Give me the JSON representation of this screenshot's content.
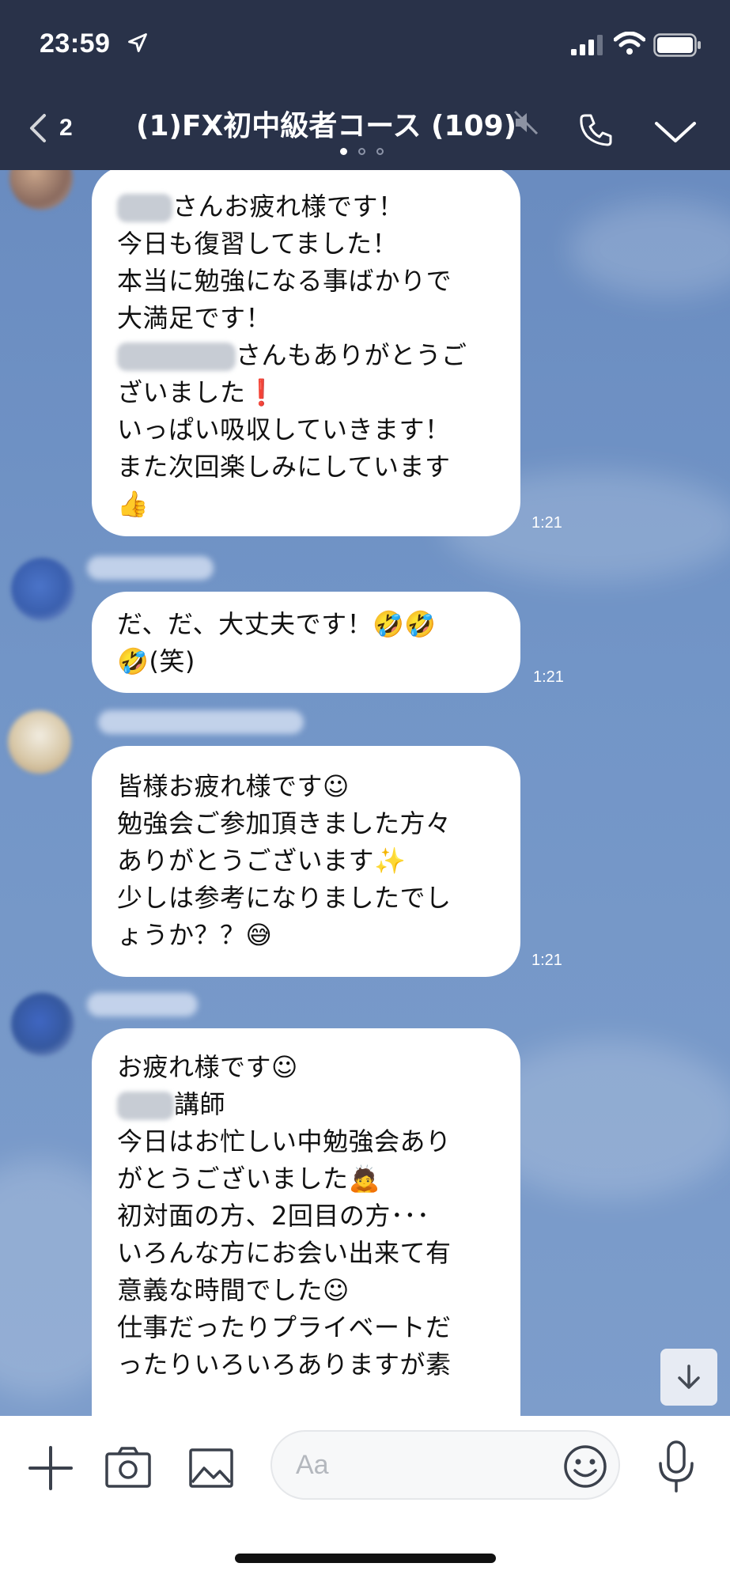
{
  "status_bar": {
    "time": "23:59"
  },
  "header": {
    "back_count": "2",
    "title": "(1)FX初中級者コース (109)"
  },
  "messages": [
    {
      "lines": [
        "さんお疲れ様です！",
        "今日も復習してました！",
        "本当に勉強になる事ばかりで",
        "大満足です！",
        "さんもありがとうご",
        "ざいました❗",
        "いっぱい吸収していきます！",
        "また次回楽しみにしています",
        "👍"
      ],
      "time": "1:21"
    },
    {
      "lines": [
        "だ、だ、大丈夫です！🤣🤣",
        "🤣(笑)"
      ],
      "time": "1:21"
    },
    {
      "lines": [
        "皆様お疲れ様です☺",
        "勉強会ご参加頂きました方々",
        "ありがとうございます✨",
        "少しは参考になりましたでし",
        "ょうか？？😅"
      ],
      "time": "1:21"
    },
    {
      "lines": [
        "お疲れ様です☺",
        "講師",
        "今日はお忙しい中勉強会あり",
        "がとうございました🙇",
        "初対面の方、2回目の方･･･",
        "いろんな方にお会い出来て有",
        "意義な時間でした☺",
        "仕事だったりプライベートだ",
        "ったりいろいろありますが素"
      ]
    }
  ],
  "input": {
    "placeholder": "Aa"
  },
  "icons": {
    "back": "chevron-left-icon",
    "mute": "mute-icon",
    "call": "phone-icon",
    "menu": "chevron-down-icon",
    "plus": "plus-icon",
    "camera": "camera-icon",
    "image": "image-icon",
    "emoji": "emoji-icon",
    "mic": "microphone-icon",
    "scroll": "arrow-down-icon"
  },
  "colors": {
    "header_bg": "#293249",
    "chat_bg": "#7295c7",
    "bubble_bg": "#ffffff"
  }
}
